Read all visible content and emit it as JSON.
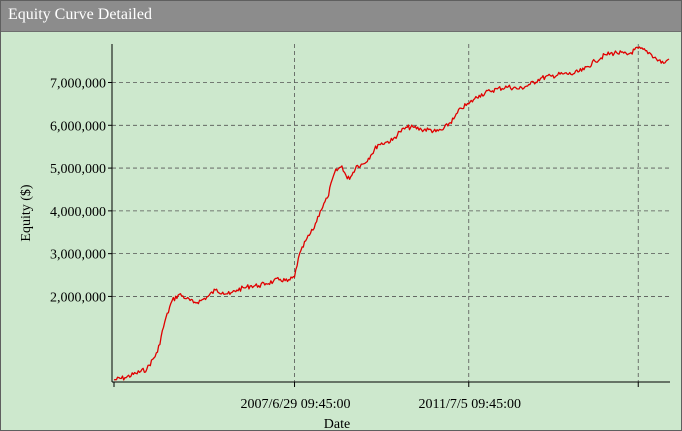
{
  "window": {
    "title": "Equity Curve Detailed"
  },
  "colors": {
    "background": "#cde8cd",
    "titlebar": "#8c8c8c",
    "line": "#e00000",
    "grid": "#555555"
  },
  "chart_data": {
    "type": "line",
    "title": "",
    "xlabel": "Date",
    "ylabel": "Equity ($)",
    "ylim": [
      0,
      7900000
    ],
    "grid": true,
    "y_ticks": [
      2000000,
      3000000,
      4000000,
      5000000,
      6000000,
      7000000
    ],
    "y_tick_labels": [
      "2,000,000",
      "3,000,000",
      "4,000,000",
      "5,000,000",
      "6,000,000",
      "7,000,000"
    ],
    "x_ticks": [
      "2007/6/29 09:45:00",
      "2011/7/5 09:45:00"
    ],
    "x_tick_labels": [
      "2007/6/29 09:45:00",
      "2011/7/5 09:45:00"
    ],
    "series": [
      {
        "x": [
          "2003-05-01",
          "2003-08-01",
          "2003-11-01",
          "2004-02-01",
          "2004-05-01",
          "2004-07-01",
          "2004-09-01",
          "2004-11-01",
          "2005-01-01",
          "2005-03-01",
          "2005-05-01",
          "2005-07-01",
          "2005-09-01",
          "2005-11-01",
          "2006-01-01",
          "2006-03-01",
          "2006-05-01",
          "2006-07-01",
          "2006-09-01",
          "2006-11-01",
          "2007-01-01",
          "2007-03-01",
          "2007-05-01",
          "2007-06-29",
          "2007-08-01",
          "2007-10-01",
          "2007-12-01",
          "2008-02-01",
          "2008-04-01",
          "2008-06-01",
          "2008-08-01",
          "2008-09-15",
          "2008-10-15",
          "2008-12-01",
          "2009-02-01",
          "2009-04-01",
          "2009-06-01",
          "2009-08-01",
          "2009-10-01",
          "2009-12-01",
          "2010-02-01",
          "2010-04-01",
          "2010-06-01",
          "2010-08-01",
          "2010-10-01",
          "2010-12-01",
          "2011-03-01",
          "2011-05-01",
          "2011-07-05",
          "2011-08-15",
          "2011-10-01",
          "2012-01-01",
          "2012-03-01",
          "2012-06-01",
          "2012-09-01",
          "2012-12-01",
          "2013-03-01",
          "2013-06-01",
          "2013-09-01",
          "2013-12-01",
          "2014-03-01",
          "2014-06-01",
          "2014-09-01",
          "2014-12-01",
          "2015-03-01",
          "2015-06-01",
          "2015-09-01",
          "2015-11-01",
          "2016-01-01",
          "2016-02-15"
        ],
        "values": [
          50000,
          100000,
          200000,
          300000,
          700000,
          1400000,
          1900000,
          2050000,
          1950000,
          1850000,
          1900000,
          2000000,
          2150000,
          2100000,
          2050000,
          2150000,
          2200000,
          2250000,
          2250000,
          2300000,
          2350000,
          2400000,
          2350000,
          2450000,
          2900000,
          3300000,
          3550000,
          4000000,
          4300000,
          4900000,
          5050000,
          4750000,
          4800000,
          5050000,
          5100000,
          5300000,
          5550000,
          5600000,
          5650000,
          5850000,
          5950000,
          5950000,
          5900000,
          5900000,
          5850000,
          5900000,
          6150000,
          6400000,
          6500000,
          6600000,
          6700000,
          6800000,
          6850000,
          6900000,
          6850000,
          6950000,
          7100000,
          7150000,
          7200000,
          7200000,
          7300000,
          7500000,
          7650000,
          7700000,
          7650000,
          7800000,
          7700000,
          7550000,
          7450000,
          7550000
        ]
      }
    ]
  }
}
